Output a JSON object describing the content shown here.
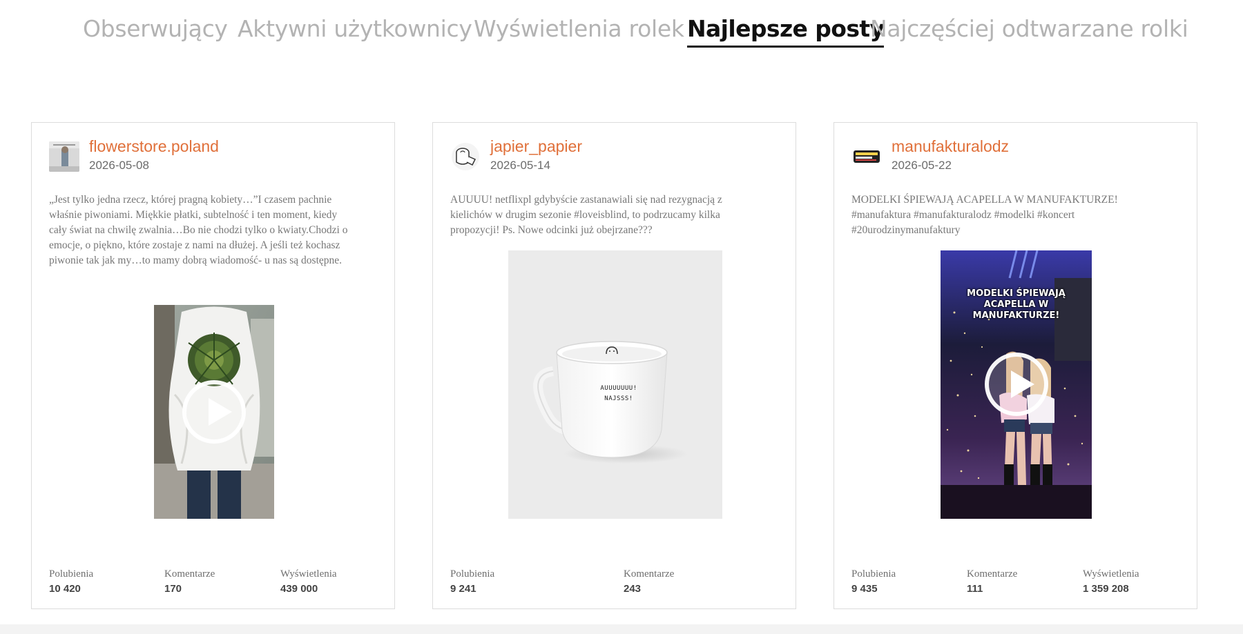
{
  "tabs": [
    {
      "label": "Obserwujący",
      "active": false
    },
    {
      "label": "Aktywni użytkownicy",
      "active": false
    },
    {
      "label": "Wyświetlenia rolek",
      "active": false
    },
    {
      "label": "Najlepsze posty",
      "active": true
    },
    {
      "label": "Najczęściej odtwarzane rolki",
      "active": false
    }
  ],
  "posts": [
    {
      "username": "flowerstore.poland",
      "date": "2026-05-08",
      "caption": "„Jest tylko jedna rzecz, której pragną kobiety…”I czasem pachnie właśnie piwoniami. Miękkie płatki, subtelność i ten moment, kiedy cały świat na chwilę zwalnia…Bo nie chodzi tylko o kwiaty.Chodzi o emocje, o piękno, które zostaje z nami na dłużej. A jeśli też kochasz piwonie tak jak my…to mamy dobrą wiadomość- u nas są dostępne.",
      "media_type": "video",
      "media_overlay": "",
      "stats": [
        {
          "label": "Polubienia",
          "value": "10 420"
        },
        {
          "label": "Komentarze",
          "value": "170"
        },
        {
          "label": "Wyświetlenia",
          "value": "439 000"
        }
      ]
    },
    {
      "username": "japier_papier",
      "date": "2026-05-14",
      "caption": "AUUUU! netflixpl gdybyście zastanawiali się nad rezygnacją z kielichów w drugim sezonie #loveisblind, to podrzucamy kilka propozycji! Ps. Nowe odcinki już obejrzane???",
      "media_type": "image",
      "mug_text": [
        "AUUUUUUU!",
        "NAJSSS!"
      ],
      "stats": [
        {
          "label": "Polubienia",
          "value": "9 241"
        },
        {
          "label": "Komentarze",
          "value": "243"
        }
      ]
    },
    {
      "username": "manufakturalodz",
      "date": "2026-05-22",
      "caption": "MODELKI ŚPIEWAJĄ ACAPELLA W MANUFAKTURZE! #manufaktura #manufakturalodz #modelki #koncert #20urodzinymanufaktury",
      "media_type": "video",
      "media_overlay": "MODELKI ŚPIEWAJĄ ACAPELLA W MANUFAKTURZE!",
      "stats": [
        {
          "label": "Polubienia",
          "value": "9 435"
        },
        {
          "label": "Komentarze",
          "value": "111"
        },
        {
          "label": "Wyświetlenia",
          "value": "1 359 208"
        }
      ]
    }
  ],
  "colors": {
    "accent": "#e0703a",
    "tab_inactive": "#b3b3b3",
    "tab_active": "#111111"
  },
  "icons": {
    "play": "play-icon"
  }
}
